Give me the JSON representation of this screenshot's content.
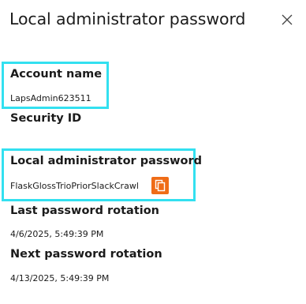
{
  "panel": {
    "title": "Local administrator password"
  },
  "fields": {
    "account_name": {
      "label": "Account name",
      "value": "LapsAdmin623511"
    },
    "security_id": {
      "label": "Security ID"
    },
    "local_admin_password": {
      "label": "Local administrator password",
      "value": "FlaskGlossTrioPriorSlackCrawl"
    },
    "last_rotation": {
      "label": "Last password rotation",
      "value": "4/6/2025, 5:49:39 PM"
    },
    "next_rotation": {
      "label": "Next password rotation",
      "value": "4/13/2025, 5:49:39 PM"
    }
  },
  "colors": {
    "highlight": "#33e0f0",
    "copy_button": "#ef6c17"
  },
  "icons": {
    "close": "close-icon",
    "copy": "copy-icon"
  }
}
